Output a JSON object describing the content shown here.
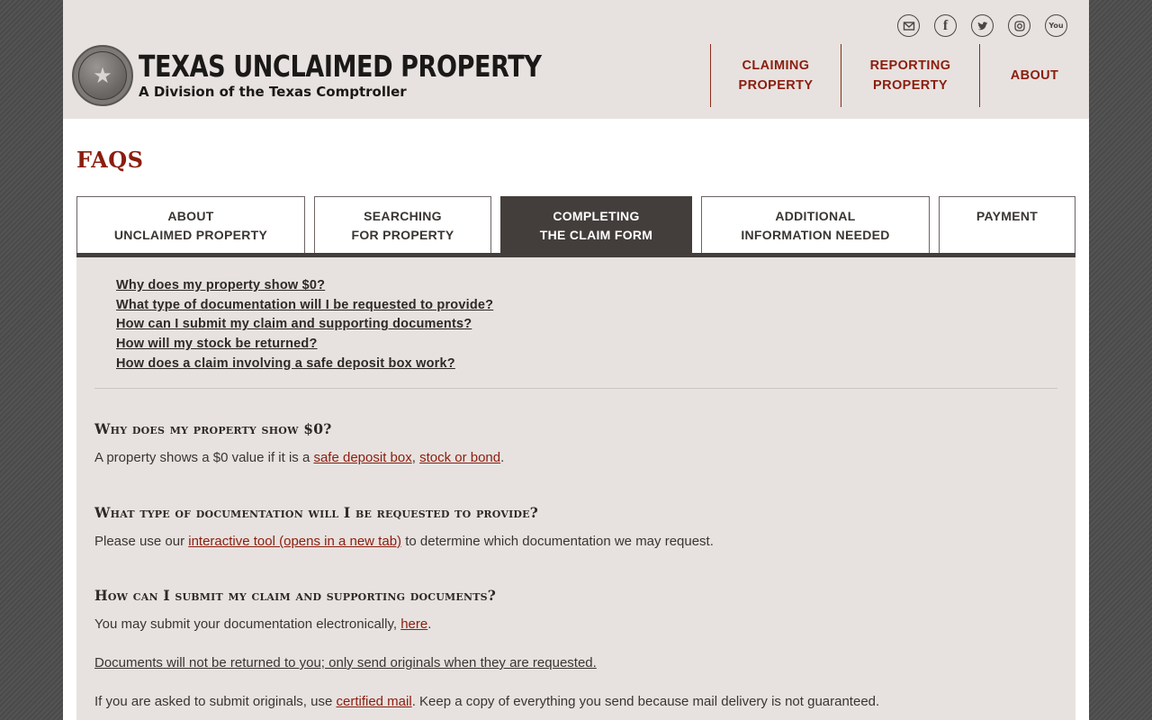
{
  "header": {
    "social": [
      {
        "name": "email-icon",
        "glyph": "✉"
      },
      {
        "name": "facebook-icon",
        "glyph": "f"
      },
      {
        "name": "twitter-icon",
        "glyph": "t"
      },
      {
        "name": "instagram-icon",
        "glyph": "◎"
      },
      {
        "name": "youtube-icon",
        "glyph": "You"
      }
    ],
    "logo_title": "TEXAS UNCLAIMED PROPERTY",
    "logo_subtitle": "A Division of the Texas Comptroller",
    "nav": {
      "claiming_line1": "CLAIMING",
      "claiming_line2": "PROPERTY",
      "reporting_line1": "REPORTING",
      "reporting_line2": "PROPERTY",
      "about": "ABOUT"
    }
  },
  "page": {
    "title": "FAQS"
  },
  "tabs": [
    {
      "line1": "ABOUT",
      "line2": "UNCLAIMED PROPERTY"
    },
    {
      "line1": "SEARCHING",
      "line2": "FOR PROPERTY"
    },
    {
      "line1": "COMPLETING",
      "line2": "THE CLAIM FORM",
      "active": true
    },
    {
      "line1": "ADDITIONAL",
      "line2": "INFORMATION NEEDED"
    },
    {
      "line1": "PAYMENT",
      "line2": ""
    }
  ],
  "jump_links": [
    "Why does my property show $0?",
    "What type of documentation will I be requested to provide?",
    "How can I submit my claim and supporting documents?",
    "How will my stock be returned?",
    "How does a claim involving a safe deposit box work?"
  ],
  "sections": {
    "s1": {
      "heading": "Why does my property show $0?",
      "text_before": "A property shows a $0 value if it is a ",
      "link1": "safe deposit box",
      "sep": ", ",
      "link2": "stock or bond",
      "text_after": "."
    },
    "s2": {
      "heading": "What type of documentation will I be requested to provide?",
      "text_before": "Please use our ",
      "link": "interactive tool (opens in a new tab)",
      "text_after": " to determine which documentation we may request."
    },
    "s3": {
      "heading": "How can I submit my claim and supporting documents?",
      "p1_before": "You may submit your documentation electronically, ",
      "p1_link": "here",
      "p1_after": ".",
      "p2": "Documents will not be returned to you; only send originals when they are requested.",
      "p3_before": "If you are asked to submit originals, use ",
      "p3_link": "certified mail",
      "p3_after": ". Keep a copy of everything you send because mail delivery is not guaranteed."
    }
  },
  "colors": {
    "accent": "#8b1d0f",
    "header_bg": "#e7e2df",
    "active_tab": "#433e3b"
  }
}
